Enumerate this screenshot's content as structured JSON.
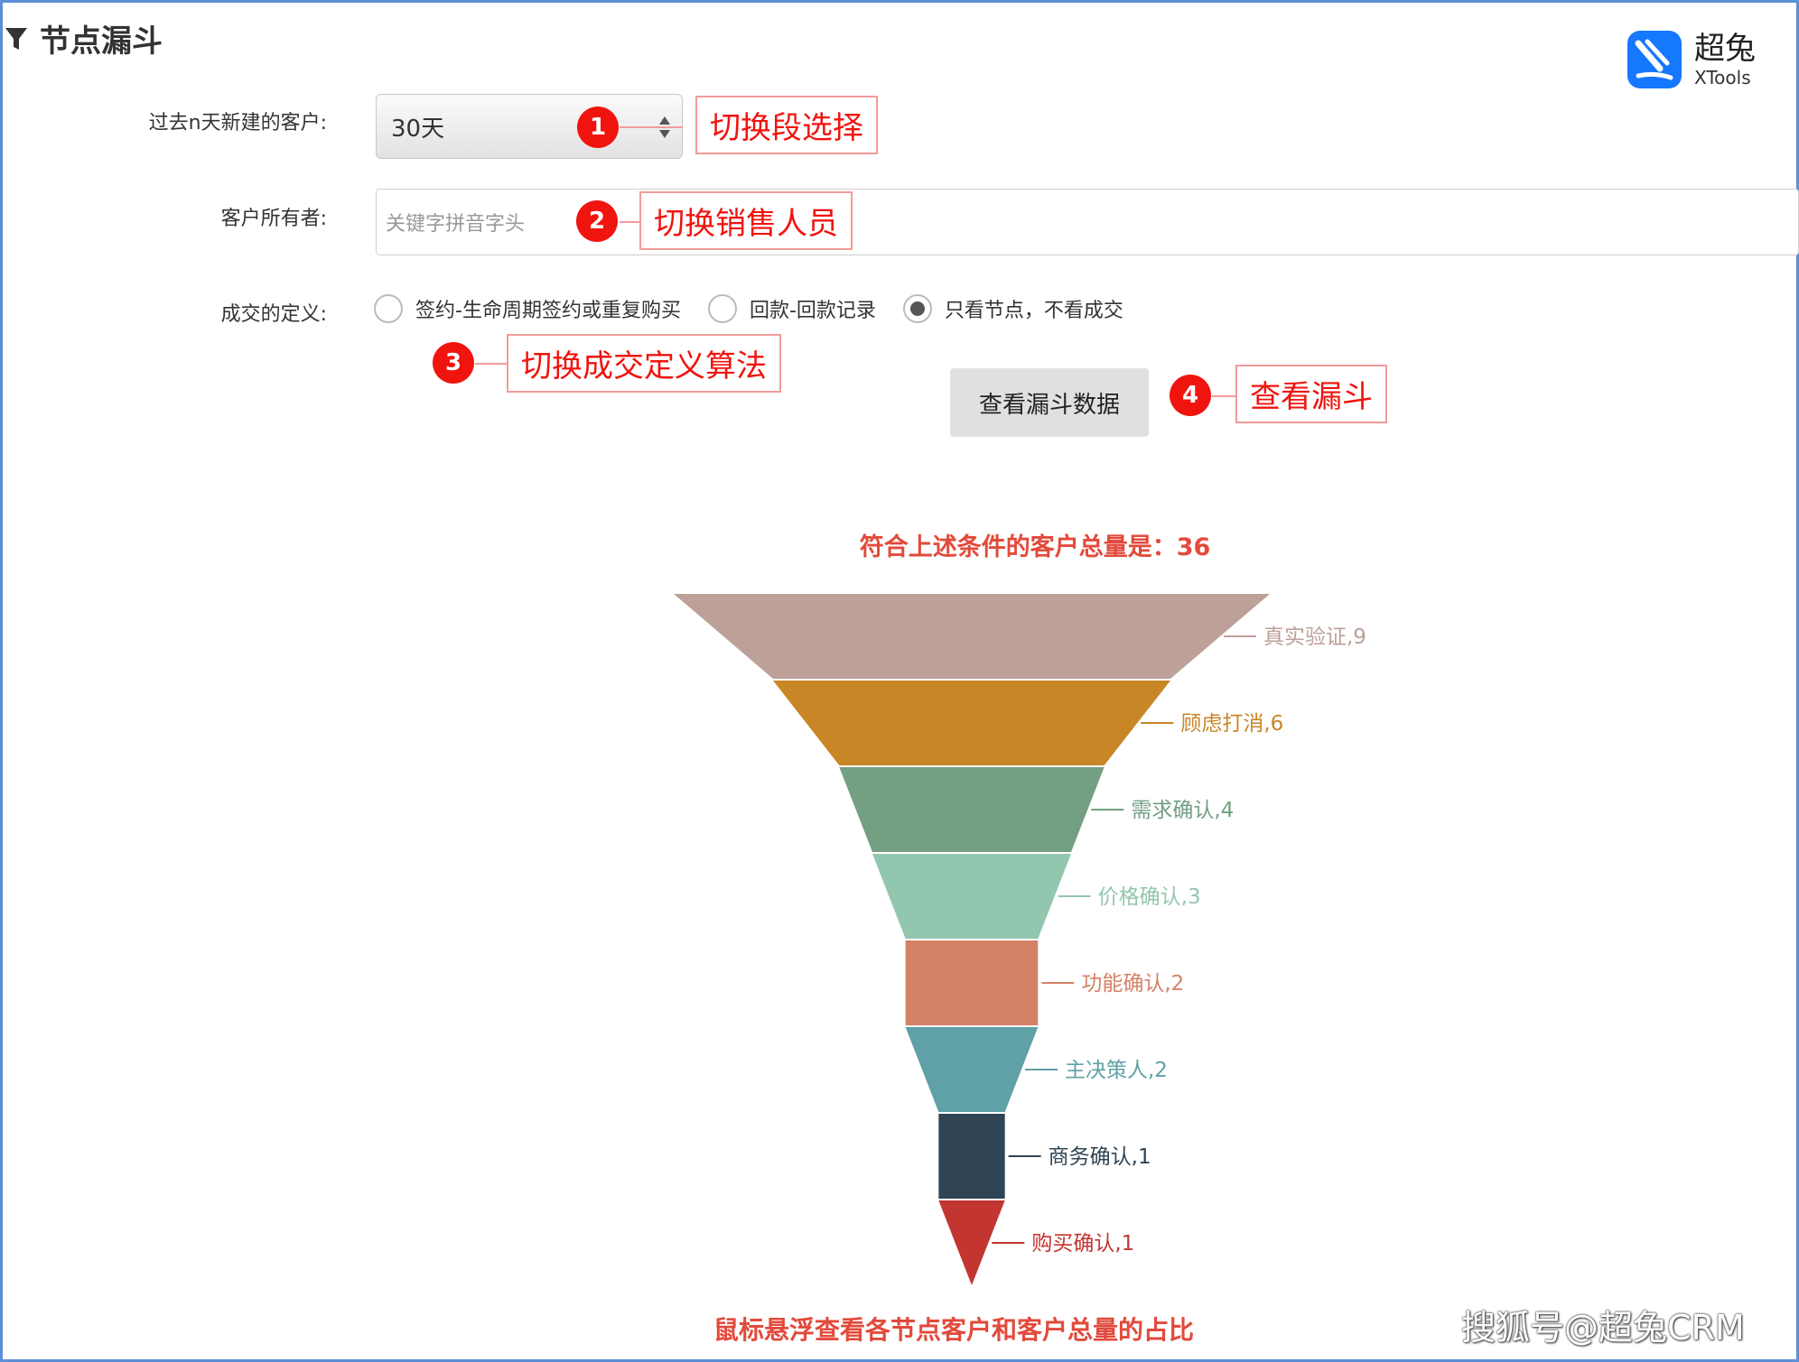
{
  "header": {
    "title": "节点漏斗"
  },
  "logo": {
    "cn": "超兔",
    "en": "XTools"
  },
  "form": {
    "period_label": "过去n天新建的客户:",
    "period_value": "30天",
    "owner_label": "客户所有者:",
    "owner_placeholder": "关键字拼音字头",
    "deal_label": "成交的定义:",
    "radios": [
      {
        "label": "签约-生命周期签约或重复购买",
        "checked": false
      },
      {
        "label": "回款-回款记录",
        "checked": false
      },
      {
        "label": "只看节点，不看成交",
        "checked": true
      }
    ],
    "button_label": "查看漏斗数据"
  },
  "annotations": [
    {
      "num": "1",
      "text": "切换段选择"
    },
    {
      "num": "2",
      "text": "切换销售人员"
    },
    {
      "num": "3",
      "text": "切换成交定义算法"
    },
    {
      "num": "4",
      "text": "查看漏斗"
    }
  ],
  "summary": "符合上述条件的客户总量是：36",
  "hint": "鼠标悬浮查看各节点客户和客户总量的占比",
  "watermark": "搜狐号@超兔CRM",
  "chart_data": {
    "type": "funnel",
    "total": 36,
    "stages": [
      {
        "name": "真实验证",
        "value": 9,
        "color": "#bda199",
        "label": "真实验证,9"
      },
      {
        "name": "顾虑打消",
        "value": 6,
        "color": "#c98627",
        "label": "顾虑打消,6"
      },
      {
        "name": "需求确认",
        "value": 4,
        "color": "#739f82",
        "label": "需求确认,4"
      },
      {
        "name": "价格确认",
        "value": 3,
        "color": "#93c6ae",
        "label": "价格确认,3"
      },
      {
        "name": "功能确认",
        "value": 2,
        "color": "#d38266",
        "label": "功能确认,2"
      },
      {
        "name": "主决策人",
        "value": 2,
        "color": "#60a0a7",
        "label": "主决策人,2"
      },
      {
        "name": "商务确认",
        "value": 1,
        "color": "#2f4454",
        "label": "商务确认,1"
      },
      {
        "name": "购买确认",
        "value": 1,
        "color": "#c23531",
        "label": "购买确认,1"
      }
    ]
  }
}
